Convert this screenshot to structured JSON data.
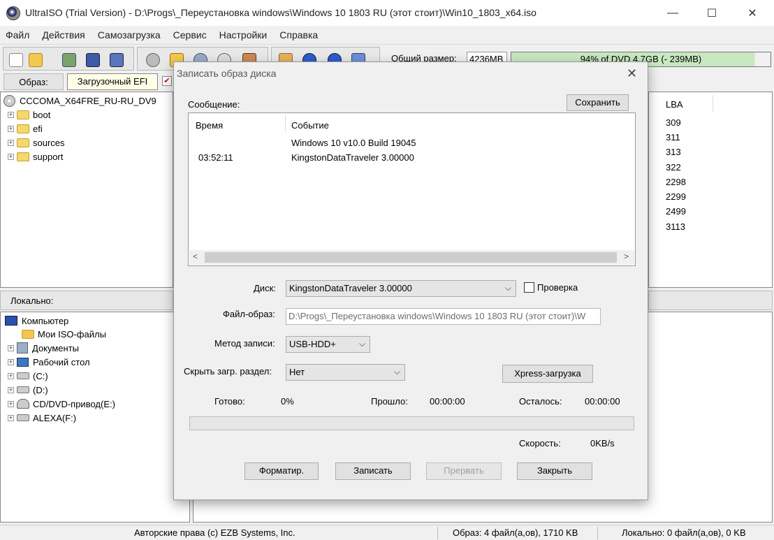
{
  "window": {
    "title": "UltraISO (Trial Version) - D:\\Progs\\_Переустановка windows\\Windows 10 1803 RU (этот стоит)\\Win10_1803_x64.iso",
    "minimize": "—",
    "maximize": "☐",
    "close": "✕"
  },
  "menu": [
    "Файл",
    "Действия",
    "Самозагрузка",
    "Сервис",
    "Настройки",
    "Справка"
  ],
  "toolbar": {
    "size_label": "Общий размер:",
    "size_value": "4236MB",
    "size_bar": "94% of DVD 4.7GB (- 239MB)",
    "size_fill_percent": 94
  },
  "image": {
    "label": "Образ:",
    "type": "Загрузочный EFI"
  },
  "image_tree": {
    "root": "CCCOMA_X64FRE_RU-RU_DV9",
    "items": [
      "boot",
      "efi",
      "sources",
      "support"
    ]
  },
  "lba": {
    "header": "LBA",
    "values": [
      "309",
      "311",
      "313",
      "322",
      "2298",
      "2299",
      "2499",
      "3113"
    ]
  },
  "local": {
    "header": "Локально:",
    "root": "Компьютер",
    "items": [
      "Мои ISO-файлы",
      "Документы",
      "Рабочий стол",
      "(C:)",
      "(D:)",
      "CD/DVD-привод(E:)",
      "ALEXA(F:)"
    ]
  },
  "status": {
    "copyright": "Авторские права (c) EZB Systems, Inc.",
    "image_info": "Образ: 4 файл(а,ов), 1710 KB",
    "local_info": "Локально: 0 файл(а,ов), 0 KB"
  },
  "dialog": {
    "title": "Записать образ диска",
    "close": "✕",
    "message_label": "Сообщение:",
    "save_button": "Сохранить",
    "log": {
      "col_time": "Время",
      "col_event": "Событие",
      "rows": [
        {
          "time": "",
          "event": "Windows 10 v10.0 Build 19045"
        },
        {
          "time": "03:52:11",
          "event": "KingstonDataTraveler 3.00000"
        }
      ]
    },
    "disk_label": "Диск:",
    "disk_value": "KingstonDataTraveler 3.00000",
    "verify_label": "Проверка",
    "verify_checked": false,
    "image_file_label": "Файл-образ:",
    "image_file_value": "D:\\Progs\\_Переустановка windows\\Windows 10 1803 RU (этот стоит)\\W",
    "method_label": "Метод записи:",
    "method_value": "USB-HDD+",
    "hide_label": "Скрыть загр. раздел:",
    "hide_value": "Нет",
    "xpress_button": "Xpress-загрузка",
    "done_label": "Готово:",
    "done_value": "0%",
    "elapsed_label": "Прошло:",
    "elapsed_value": "00:00:00",
    "remaining_label": "Осталось:",
    "remaining_value": "00:00:00",
    "speed_label": "Скорость:",
    "speed_value": "0KB/s",
    "progress_percent": 0,
    "buttons": {
      "format": "Форматир.",
      "write": "Записать",
      "abort": "Прервать",
      "close": "Закрыть"
    }
  }
}
